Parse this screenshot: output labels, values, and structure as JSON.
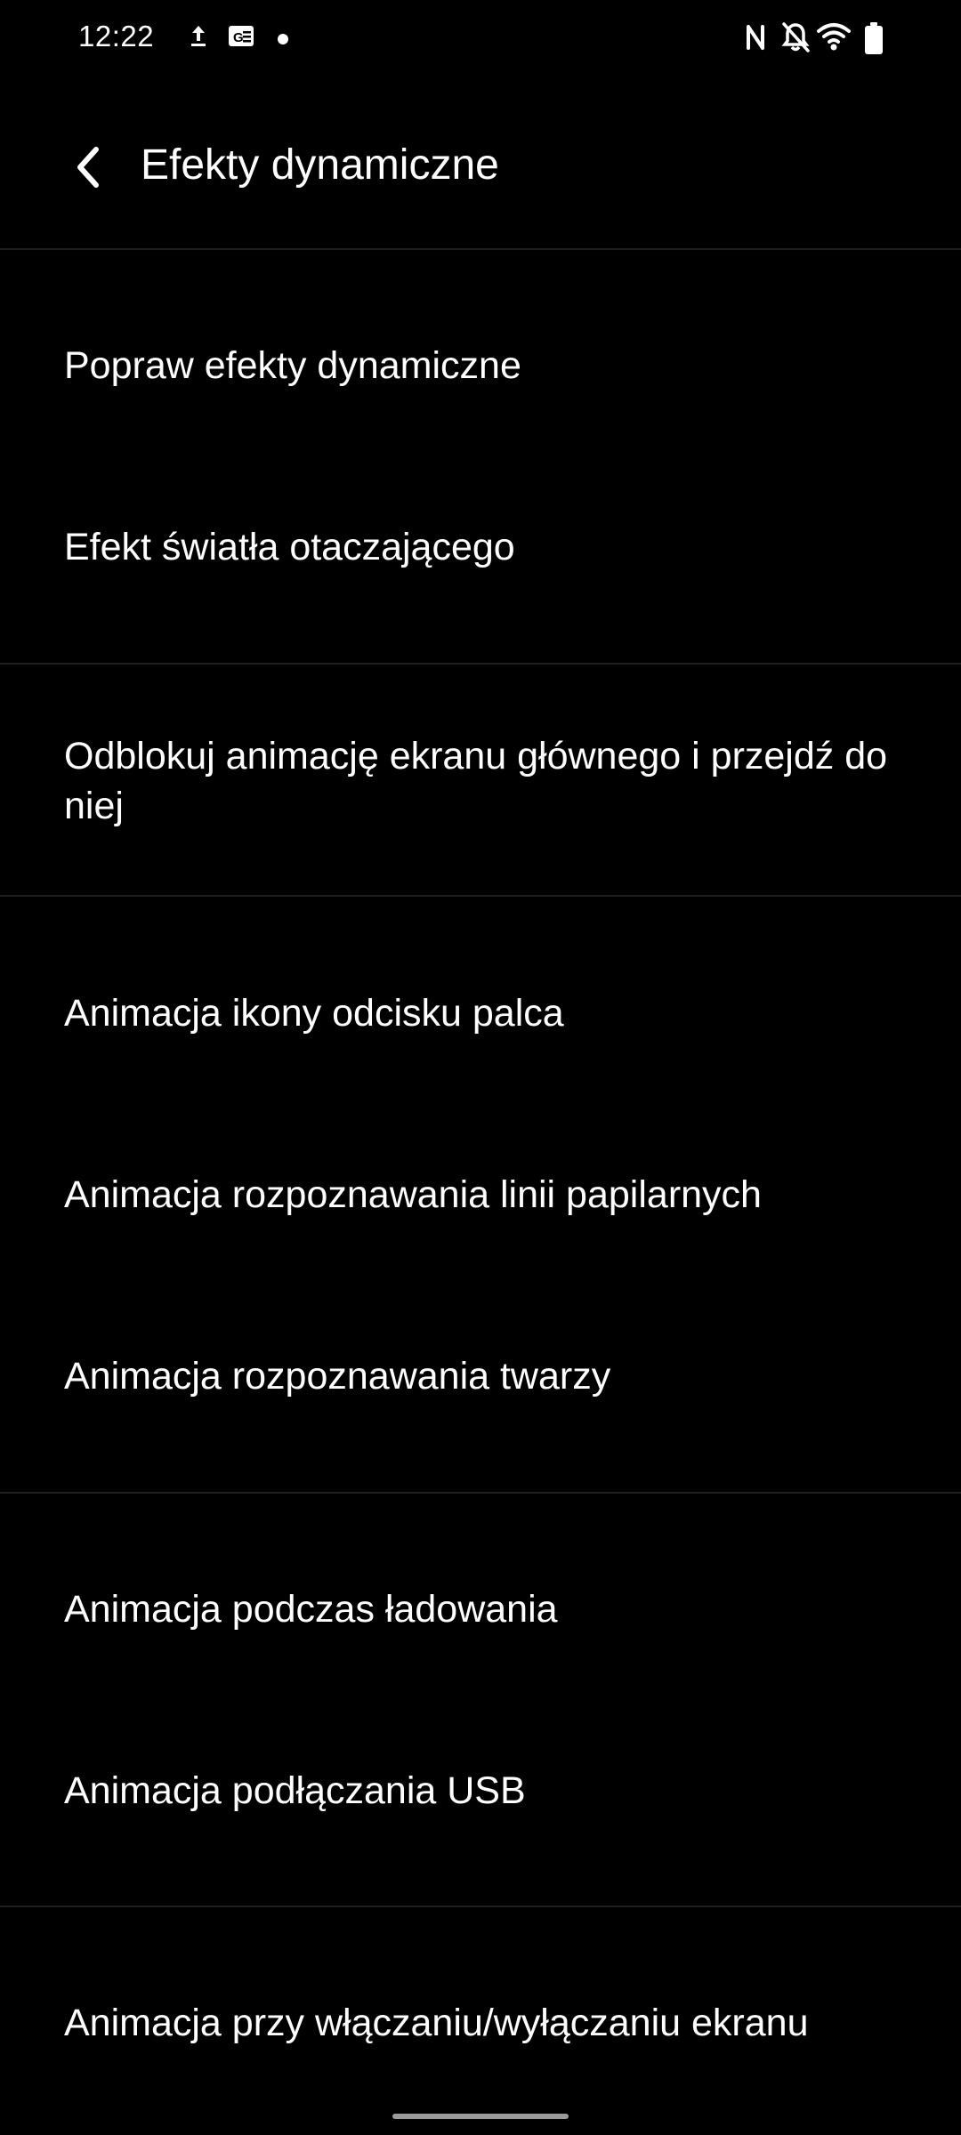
{
  "status_bar": {
    "time": "12:22",
    "left_icons": [
      "upload-icon",
      "news-icon",
      "dot-icon"
    ],
    "right_icons": [
      "nfc-icon",
      "bell-muted-icon",
      "wifi-icon",
      "battery-icon"
    ]
  },
  "header": {
    "title": "Efekty dynamiczne",
    "back_icon": "chevron-left-icon"
  },
  "sections": [
    {
      "items": [
        {
          "label": "Popraw efekty dynamiczne"
        },
        {
          "label": "Efekt światła otaczającego"
        }
      ]
    },
    {
      "items": [
        {
          "label": "Odblokuj animację ekranu głównego i przejdź do niej"
        }
      ]
    },
    {
      "items": [
        {
          "label": "Animacja ikony odcisku palca"
        },
        {
          "label": "Animacja rozpoznawania linii papilarnych"
        },
        {
          "label": "Animacja rozpoznawania twarzy"
        }
      ]
    },
    {
      "items": [
        {
          "label": "Animacja podczas ładowania"
        },
        {
          "label": "Animacja podłączania USB"
        }
      ]
    },
    {
      "items": [
        {
          "label": "Animacja przy włączaniu/wyłączaniu ekranu"
        }
      ]
    }
  ],
  "colors": {
    "background": "#000000",
    "text": "#ffffff",
    "divider": "#1f1f1f"
  }
}
